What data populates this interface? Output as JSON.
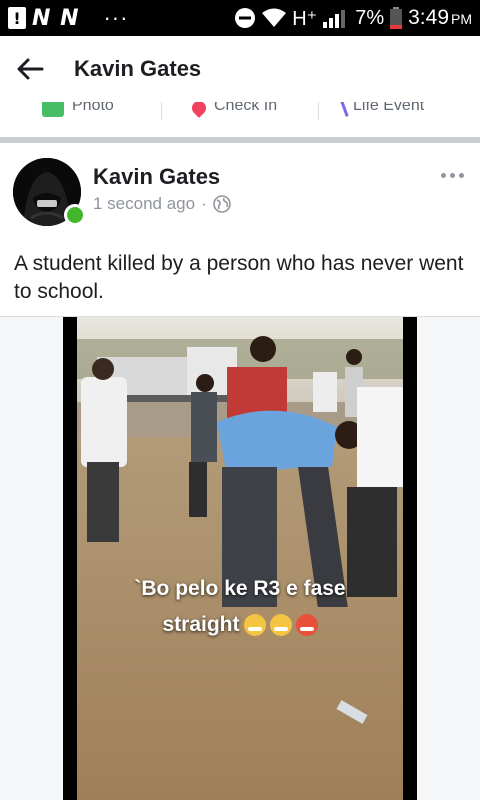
{
  "status_bar": {
    "notify_icon": "alert-icon",
    "carrier_marks": "N N",
    "overflow": "···",
    "network": "H⁺",
    "battery_percent": "7%",
    "time": "3:49",
    "ampm": "PM"
  },
  "app_bar": {
    "title": "Kavin Gates"
  },
  "composer_actions": [
    {
      "label": "Photo",
      "icon": "photo-icon",
      "color": "#45bd62"
    },
    {
      "label": "Check In",
      "icon": "location-pin-icon",
      "color": "#f3425f"
    },
    {
      "label": "Life Event",
      "icon": "flag-icon",
      "color": "#7b68ee"
    }
  ],
  "post": {
    "author": "Kavin Gates",
    "timestamp": "1 second ago",
    "separator": "·",
    "privacy_icon": "globe-icon",
    "text": "A student killed by a person who has never went to school.",
    "online_color": "#42b72a",
    "video": {
      "caption_line1": "`Bo pelo ke R3 e fase",
      "caption_line2": "straight"
    }
  }
}
